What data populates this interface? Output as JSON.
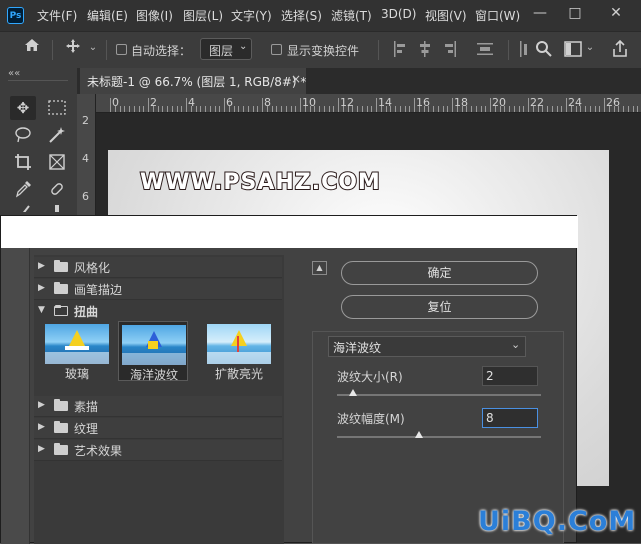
{
  "menubar": {
    "app_icon": "Ps",
    "items": [
      "文件(F)",
      "编辑(E)",
      "图像(I)",
      "图层(L)",
      "文字(Y)",
      "选择(S)",
      "滤镜(T)",
      "3D(D)",
      "视图(V)",
      "窗口(W)"
    ],
    "window_controls": {
      "minimize": "—",
      "maximize": "□",
      "close": "✕"
    }
  },
  "options_bar": {
    "auto_select_label": "自动选择：",
    "layer_select_value": "图层",
    "show_transform_label": "显示变换控件"
  },
  "tab": {
    "collapse": "««",
    "title": "未标题-1 @ 66.7% (图层 1, RGB/8#) *",
    "close": "×"
  },
  "ruler": {
    "h_ticks": [
      "0",
      "2",
      "4",
      "6",
      "8",
      "10",
      "12",
      "14",
      "16",
      "18",
      "20",
      "22",
      "24",
      "26"
    ],
    "v_ticks": [
      "2",
      "4",
      "6"
    ]
  },
  "document": {
    "text": "WWW.PSAHZ.COM"
  },
  "filter_gallery": {
    "categories_top": [
      {
        "label": "风格化",
        "expanded": false
      },
      {
        "label": "画笔描边",
        "expanded": false
      },
      {
        "label": "扭曲",
        "expanded": true
      }
    ],
    "distort_filters": [
      {
        "label": "玻璃",
        "selected": false
      },
      {
        "label": "海洋波纹",
        "selected": true
      },
      {
        "label": "扩散亮光",
        "selected": false
      }
    ],
    "categories_bottom": [
      {
        "label": "素描"
      },
      {
        "label": "纹理"
      },
      {
        "label": "艺术效果"
      }
    ],
    "ok_label": "确定",
    "reset_label": "复位",
    "selected_filter": "海洋波纹",
    "params": [
      {
        "label": "波纹大小(R)",
        "value": "2",
        "slider_fraction": 0.08
      },
      {
        "label": "波纹幅度(M)",
        "value": "8",
        "slider_fraction": 0.4
      }
    ]
  },
  "watermark": "UiBQ.CoM"
}
